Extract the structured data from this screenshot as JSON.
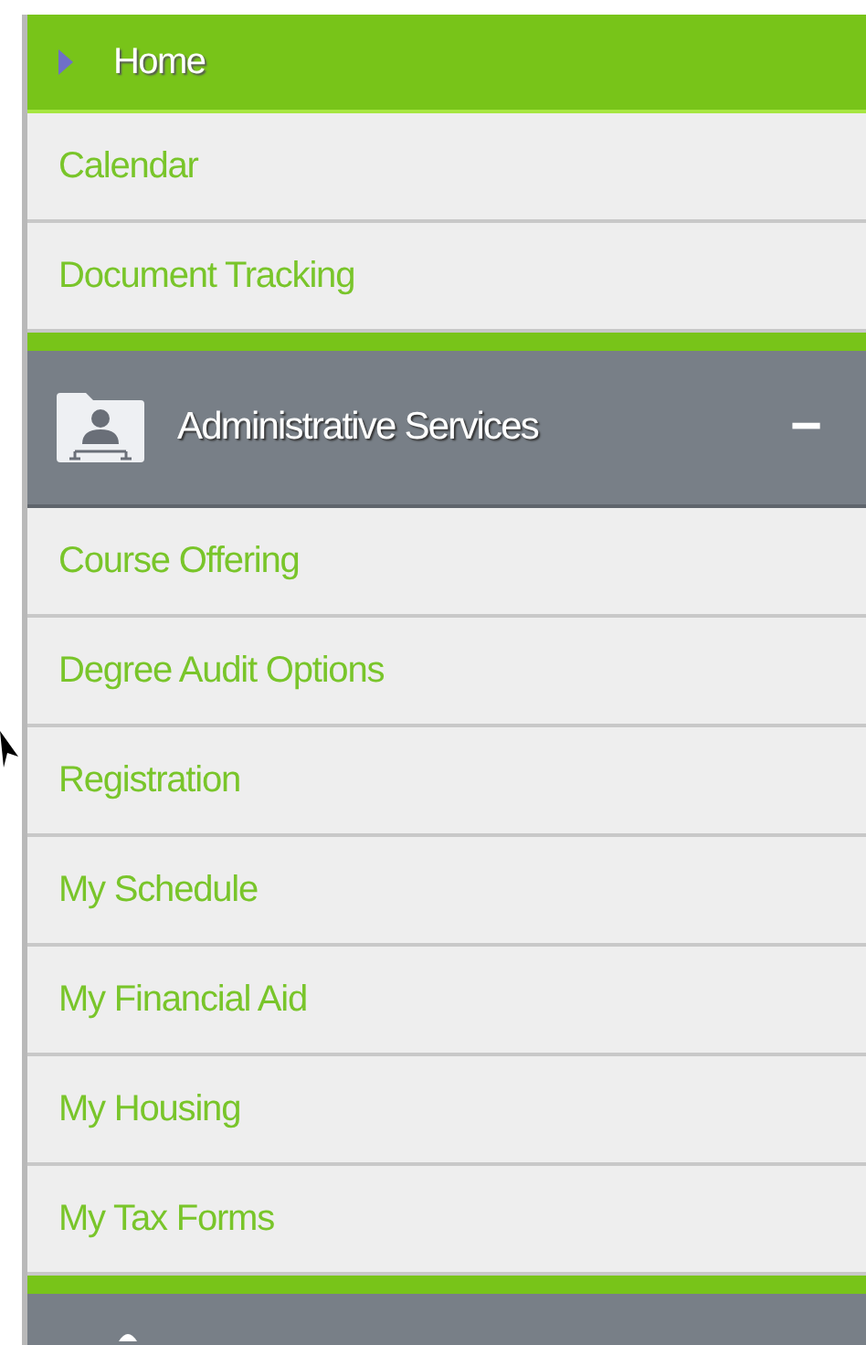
{
  "home": {
    "label": "Home",
    "selected": true
  },
  "links": [
    {
      "label": "Calendar",
      "selected": false
    },
    {
      "label": "Document Tracking",
      "selected": false
    }
  ],
  "section": {
    "title": "Administrative Services",
    "expanded": true,
    "toggle": "−",
    "items": [
      {
        "label": "Course Offering",
        "selected": false
      },
      {
        "label": "Degree Audit Options",
        "selected": false
      },
      {
        "label": "Registration",
        "selected": false
      },
      {
        "label": "My Schedule",
        "selected": false
      },
      {
        "label": "My Financial Aid",
        "selected": false
      },
      {
        "label": "My Housing",
        "selected": false
      },
      {
        "label": "My Tax Forms",
        "selected": false
      }
    ]
  }
}
